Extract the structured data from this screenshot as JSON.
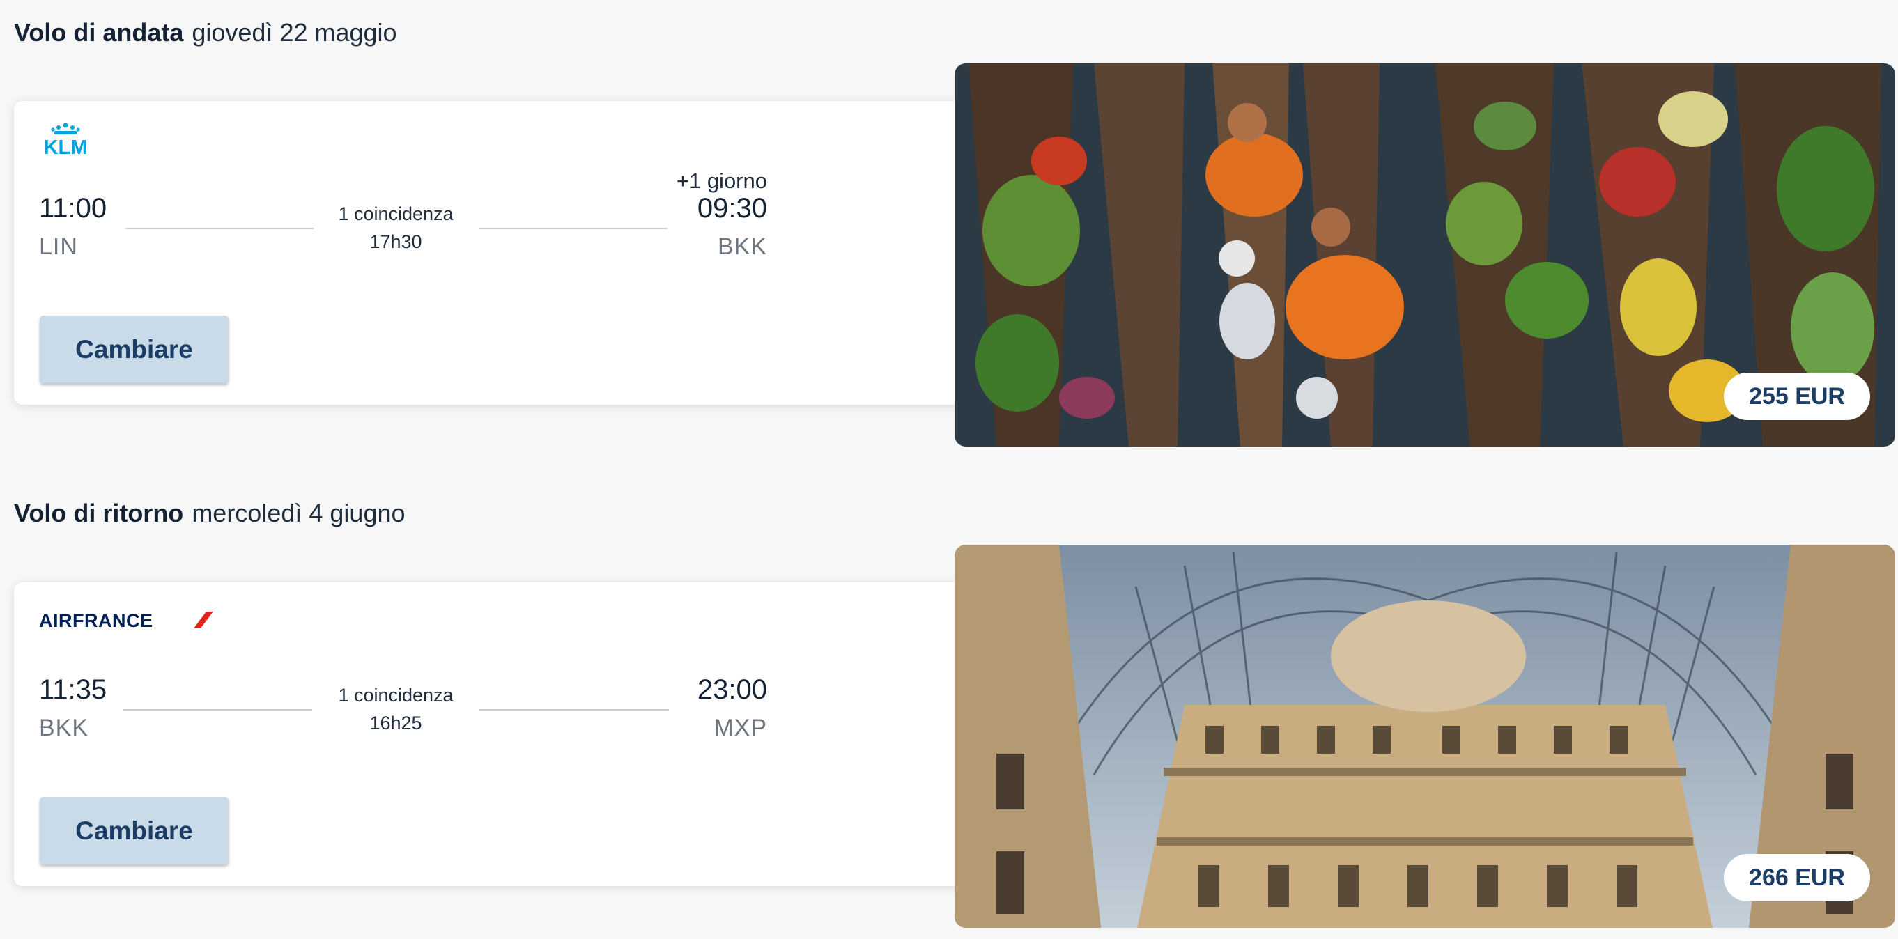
{
  "outbound": {
    "heading": "Volo di andata",
    "date": "giovedì 22 maggio",
    "airline": "KLM",
    "depart_time": "11:00",
    "depart_airport": "LIN",
    "arrive_time": "09:30",
    "arrive_airport": "BKK",
    "day_offset": "+1 giorno",
    "connections": "1 coincidenza",
    "duration": "17h30",
    "change_label": "Cambiare",
    "price": "255 EUR",
    "image": "floating-market-boats-photo"
  },
  "return": {
    "heading": "Volo di ritorno",
    "date": "mercoledì 4 giugno",
    "airline": "AIRFRANCE",
    "depart_time": "11:35",
    "depart_airport": "BKK",
    "arrive_time": "23:00",
    "arrive_airport": "MXP",
    "connections": "1 coincidenza",
    "duration": "16h25",
    "change_label": "Cambiare",
    "price": "266 EUR",
    "image": "galleria-vittorio-emanuele-photo"
  },
  "colors": {
    "klm_blue": "#00a1de",
    "airfrance_navy": "#002157",
    "airfrance_red": "#e1241d",
    "button_bg": "#c9dbe8",
    "button_text": "#1c3e66"
  }
}
